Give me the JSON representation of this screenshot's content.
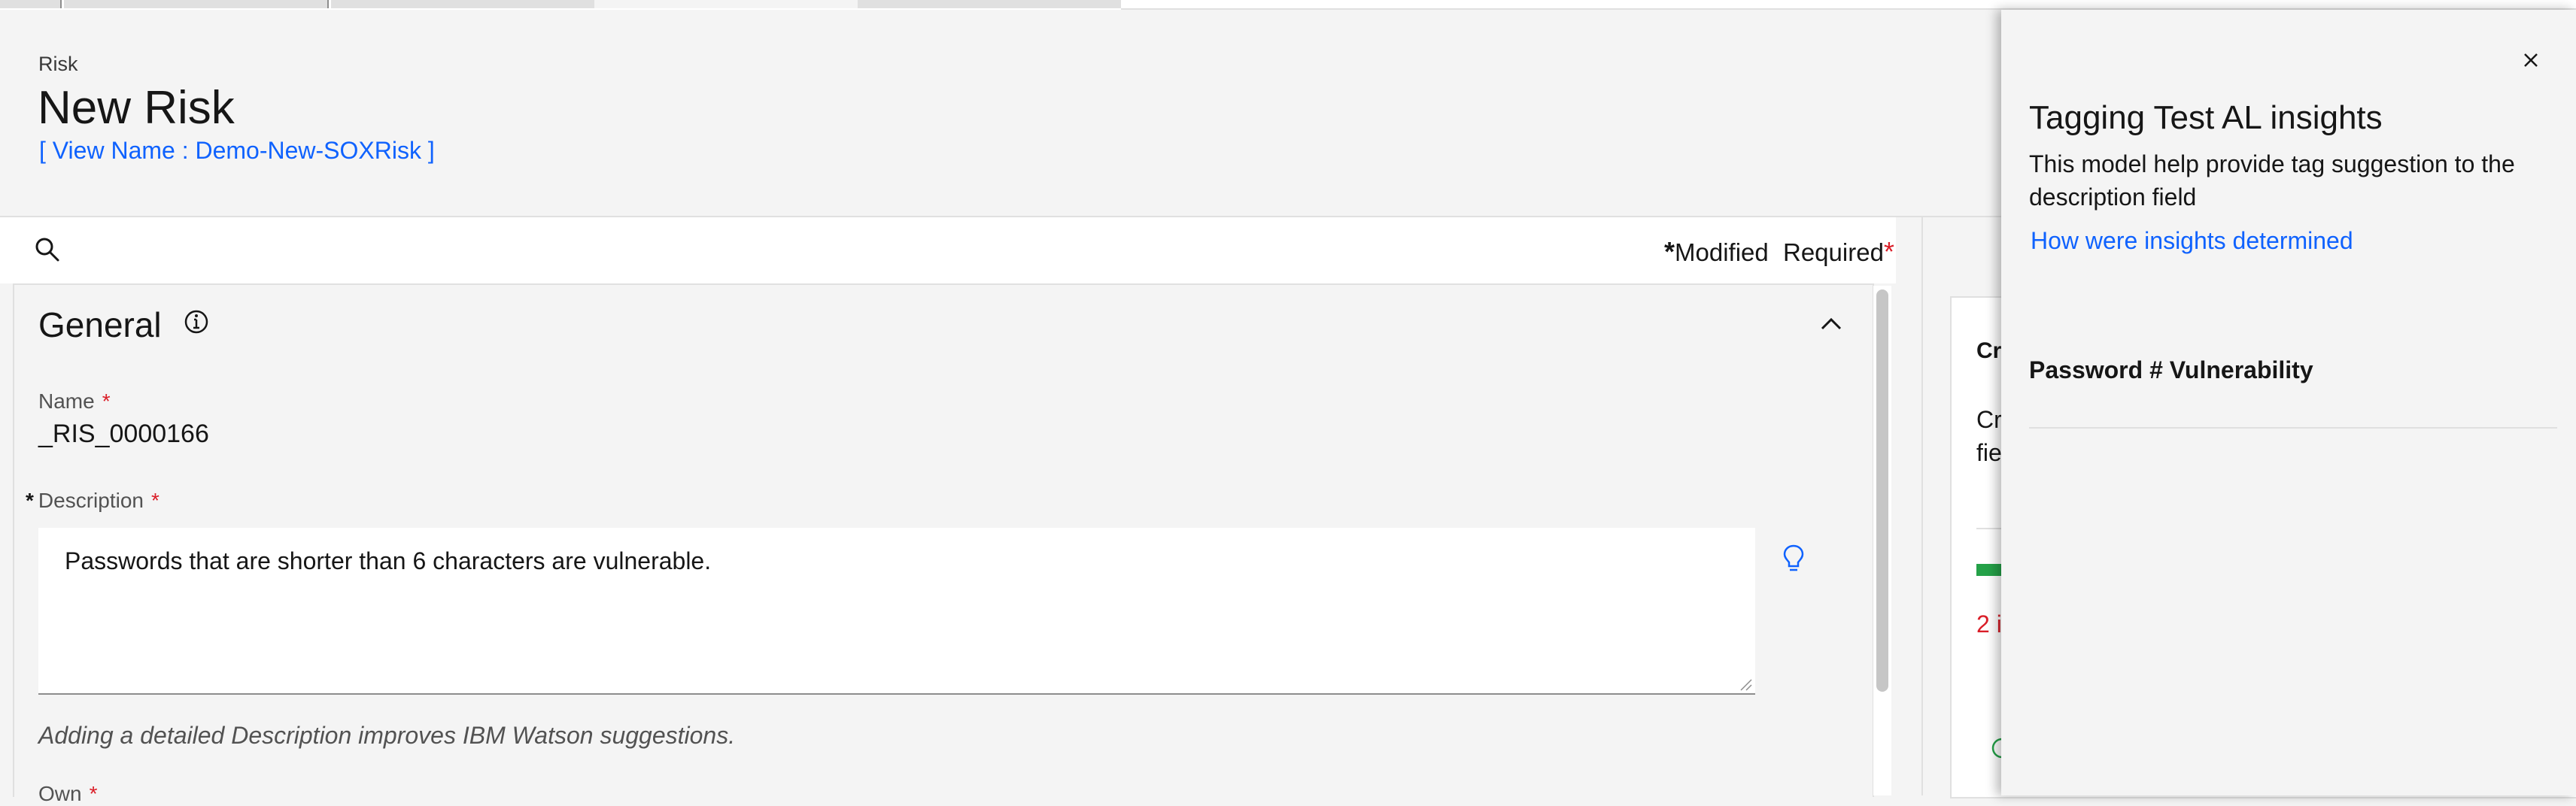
{
  "header": {
    "breadcrumb": "Risk",
    "title": "New Risk",
    "view_name": "[ View Name : Demo-New-SOXRisk ]"
  },
  "toolbar": {
    "search_icon": "search-icon",
    "modified_star": "*",
    "modified_label": "Modified",
    "required_label": "Required",
    "required_star": "*"
  },
  "section": {
    "title": "General",
    "info_icon": "info-icon",
    "collapse_icon": "chevron-up-icon"
  },
  "fields": {
    "name_label": "Name",
    "name_required": "*",
    "name_value": "_RIS_0000166",
    "description_modified": "*",
    "description_label": "Description",
    "description_required": "*",
    "description_value": "Passwords that are shorter than 6 characters are vulnerable.",
    "insight_icon": "lightbulb-icon",
    "helper_text": "Adding a detailed Description improves IBM Watson suggestions.",
    "next_label": "Own",
    "next_required": "*"
  },
  "right_card": {
    "title_fragment": "Cr",
    "text_fragment_1": "Cr",
    "text_fragment_2": "fie",
    "issues_fragment": "2 i",
    "progress_color": "#24a148"
  },
  "insights_panel": {
    "title": "Tagging Test AL insights",
    "description": "This model help provide tag suggestion to the description field",
    "link": "How were insights determined",
    "suggestion": "Password # Vulnerability",
    "close_icon": "close-icon"
  },
  "colors": {
    "link": "#0f62fe",
    "required": "#da1e28",
    "background": "#f4f4f4"
  }
}
